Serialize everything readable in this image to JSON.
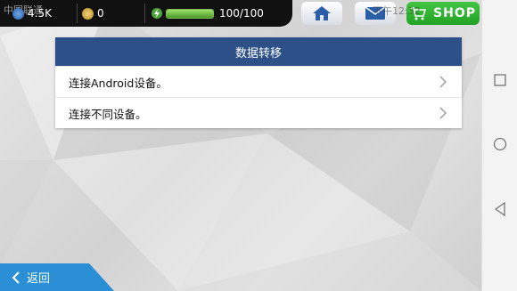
{
  "hud": {
    "carrier": "中国联通",
    "diamonds": "4.5K",
    "coins": "0",
    "energy": "100/100",
    "energy_fraction": 1.0
  },
  "status_time": "下午12:32",
  "top_buttons": {
    "shop_label": "SHOP"
  },
  "panel": {
    "title": "数据转移",
    "rows": [
      {
        "label": "连接Android设备。"
      },
      {
        "label": "连接不同设备。"
      }
    ]
  },
  "back": {
    "label": "返回"
  },
  "colors": {
    "header_blue": "#2d5089",
    "back_blue": "#2b8fd6",
    "shop_green": "#2fb52f",
    "energy_green": "#6cc03e"
  }
}
